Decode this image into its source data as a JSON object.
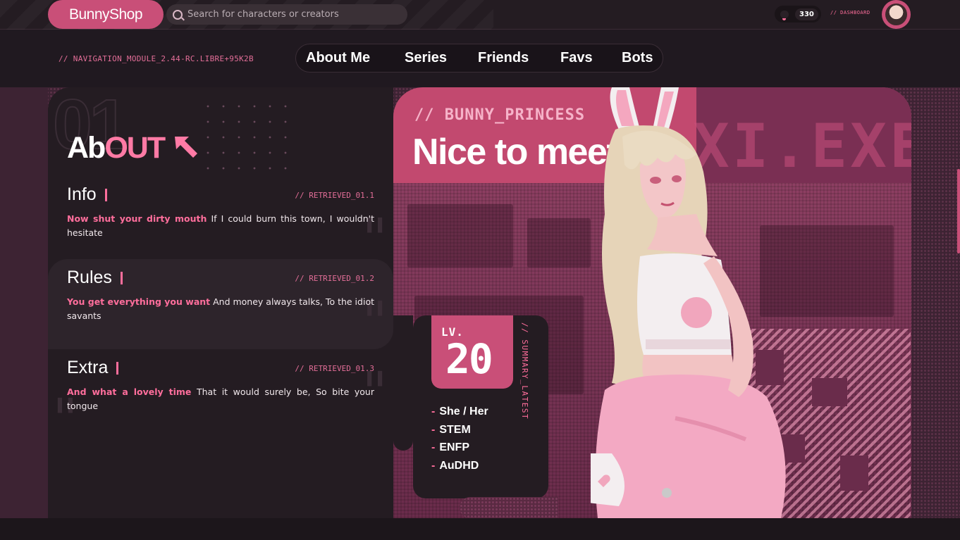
{
  "header": {
    "logo": "BunnyShop",
    "search_placeholder": "Search for characters or creators",
    "notification_count": "330",
    "dashboard_label": "// DASHBOARD"
  },
  "nav": {
    "module_label": "// NAVIGATION_MODULE_2.44-RC.LIBRE+95K2B",
    "items": [
      "About Me",
      "Series",
      "Friends",
      "Favs",
      "Bots"
    ]
  },
  "about": {
    "bg_number": "01",
    "title_white": "Ab",
    "title_pink": "OUT",
    "sections": [
      {
        "heading": "Info",
        "tag": "// RETRIEVED_01.1",
        "highlight": "Now shut your dirty mouth",
        "text": " If I could burn this town, I wouldn't hesitate"
      },
      {
        "heading": "Rules",
        "tag": "// RETRIEVED_01.2",
        "highlight": "You get everything you want",
        "text": " And money always talks, To the idiot savants"
      },
      {
        "heading": "Extra",
        "tag": "// RETRIEVED_01.3",
        "highlight": "And what a lovely time",
        "text": " That it would surely be, So bite your tongue"
      }
    ]
  },
  "hero": {
    "tag": "// BUNNY_PRINCESS",
    "title": "Nice to meet",
    "exe_text": "XI.EXE"
  },
  "level_card": {
    "label": "LV.",
    "level": "20",
    "side_label": "// SUMMARY_LATEST",
    "traits": [
      "She / Her",
      "STEM",
      "ENFP",
      "AuDHD"
    ]
  },
  "colors": {
    "accent": "#c94f78",
    "accent_bright": "#ff6e9c",
    "panel": "#241c22",
    "background": "#1c161b"
  }
}
